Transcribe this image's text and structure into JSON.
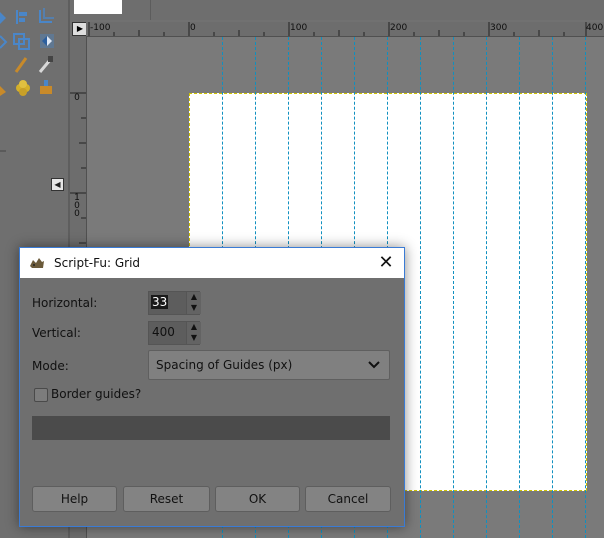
{
  "toolbox": {
    "tools": [
      {
        "name": "move-tool-icon",
        "color": "#4a86c8"
      },
      {
        "name": "align-tool-icon",
        "color": "#4a86c8"
      },
      {
        "name": "crop-tool-icon",
        "color": "#4a86c8"
      },
      {
        "name": "rotate-tool-icon",
        "color": "#4a86c8"
      },
      {
        "name": "scale-tool-icon",
        "color": "#4a86c8"
      },
      {
        "name": "flip-tool-icon",
        "color": "#4a86c8"
      },
      {
        "name": "pencil-tool-icon",
        "color": "#c88a2a"
      },
      {
        "name": "paintbrush-tool-icon",
        "color": "#c88a2a"
      },
      {
        "name": "heal-tool-icon",
        "color": "#d4b02a"
      },
      {
        "name": "clone-tool-icon",
        "color": "#c88a2a"
      }
    ],
    "panel_toggle": "◀"
  },
  "ruler": {
    "corner": "▶",
    "h_labels": [
      "-100",
      "0",
      "100",
      "200",
      "300",
      "400"
    ],
    "v_labels": [
      "0",
      "1\n0\n0"
    ]
  },
  "dialog": {
    "title": "Script-Fu: Grid",
    "close": "✕",
    "horizontal_label": "Horizontal:",
    "horizontal_value": "33",
    "vertical_label": "Vertical:",
    "vertical_value": "400",
    "mode_label": "Mode:",
    "mode_value": "Spacing of Guides (px)",
    "border_guides_label": "Border guides?",
    "border_guides_checked": false,
    "buttons": {
      "help": "Help",
      "reset": "Reset",
      "ok": "OK",
      "cancel": "Cancel"
    }
  },
  "colors": {
    "guide": "#1090c0",
    "selection_border": "#d0c400",
    "accent": "#3a7bd5"
  }
}
